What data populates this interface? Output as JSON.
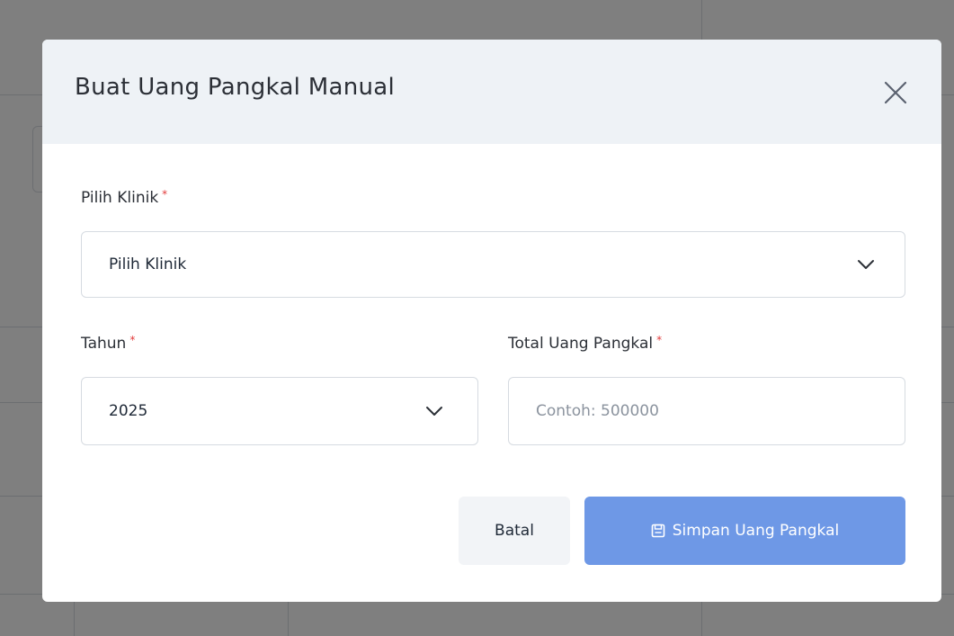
{
  "modal": {
    "title": "Buat Uang Pangkal Manual",
    "close_icon": "close-icon"
  },
  "form": {
    "clinic": {
      "label": "Pilih Klinik",
      "required_mark": "*",
      "selected_value": "Pilih Klinik"
    },
    "year": {
      "label": "Tahun",
      "required_mark": "*",
      "selected_value": "2025"
    },
    "total": {
      "label": "Total Uang Pangkal",
      "required_mark": "*",
      "value": "",
      "placeholder": "Contoh: 500000"
    }
  },
  "actions": {
    "cancel_label": "Batal",
    "save_label": "Simpan Uang Pangkal",
    "save_icon": "save-icon"
  },
  "colors": {
    "overlay": "#000000",
    "header_bg": "#eef2f6",
    "primary": "#6e98e6",
    "required": "#e23b3b"
  }
}
